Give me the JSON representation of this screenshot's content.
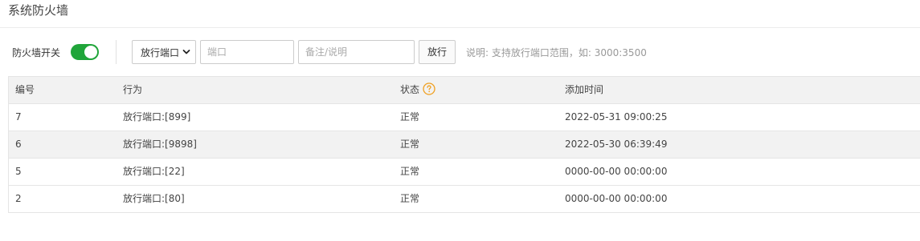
{
  "page": {
    "title": "系统防火墙"
  },
  "toolbar": {
    "switch_label": "防火墙开关",
    "switch_on": true,
    "select_value": "放行端口",
    "port_placeholder": "端口",
    "note_placeholder": "备注/说明",
    "allow_button": "放行",
    "help_text": "说明: 支持放行端口范围，如: 3000:3500"
  },
  "colors": {
    "toggle_on": "#20a53a",
    "help_icon": "#f0a020"
  },
  "table": {
    "columns": [
      "编号",
      "行为",
      "状态",
      "添加时间"
    ],
    "status_help_icon": "question-circle-icon",
    "rows": [
      {
        "id": "7",
        "action": "放行端口:[899]",
        "status": "正常",
        "time": "2022-05-31 09:00:25"
      },
      {
        "id": "6",
        "action": "放行端口:[9898]",
        "status": "正常",
        "time": "2022-05-30 06:39:49"
      },
      {
        "id": "5",
        "action": "放行端口:[22]",
        "status": "正常",
        "time": "0000-00-00 00:00:00"
      },
      {
        "id": "2",
        "action": "放行端口:[80]",
        "status": "正常",
        "time": "0000-00-00 00:00:00"
      }
    ]
  }
}
